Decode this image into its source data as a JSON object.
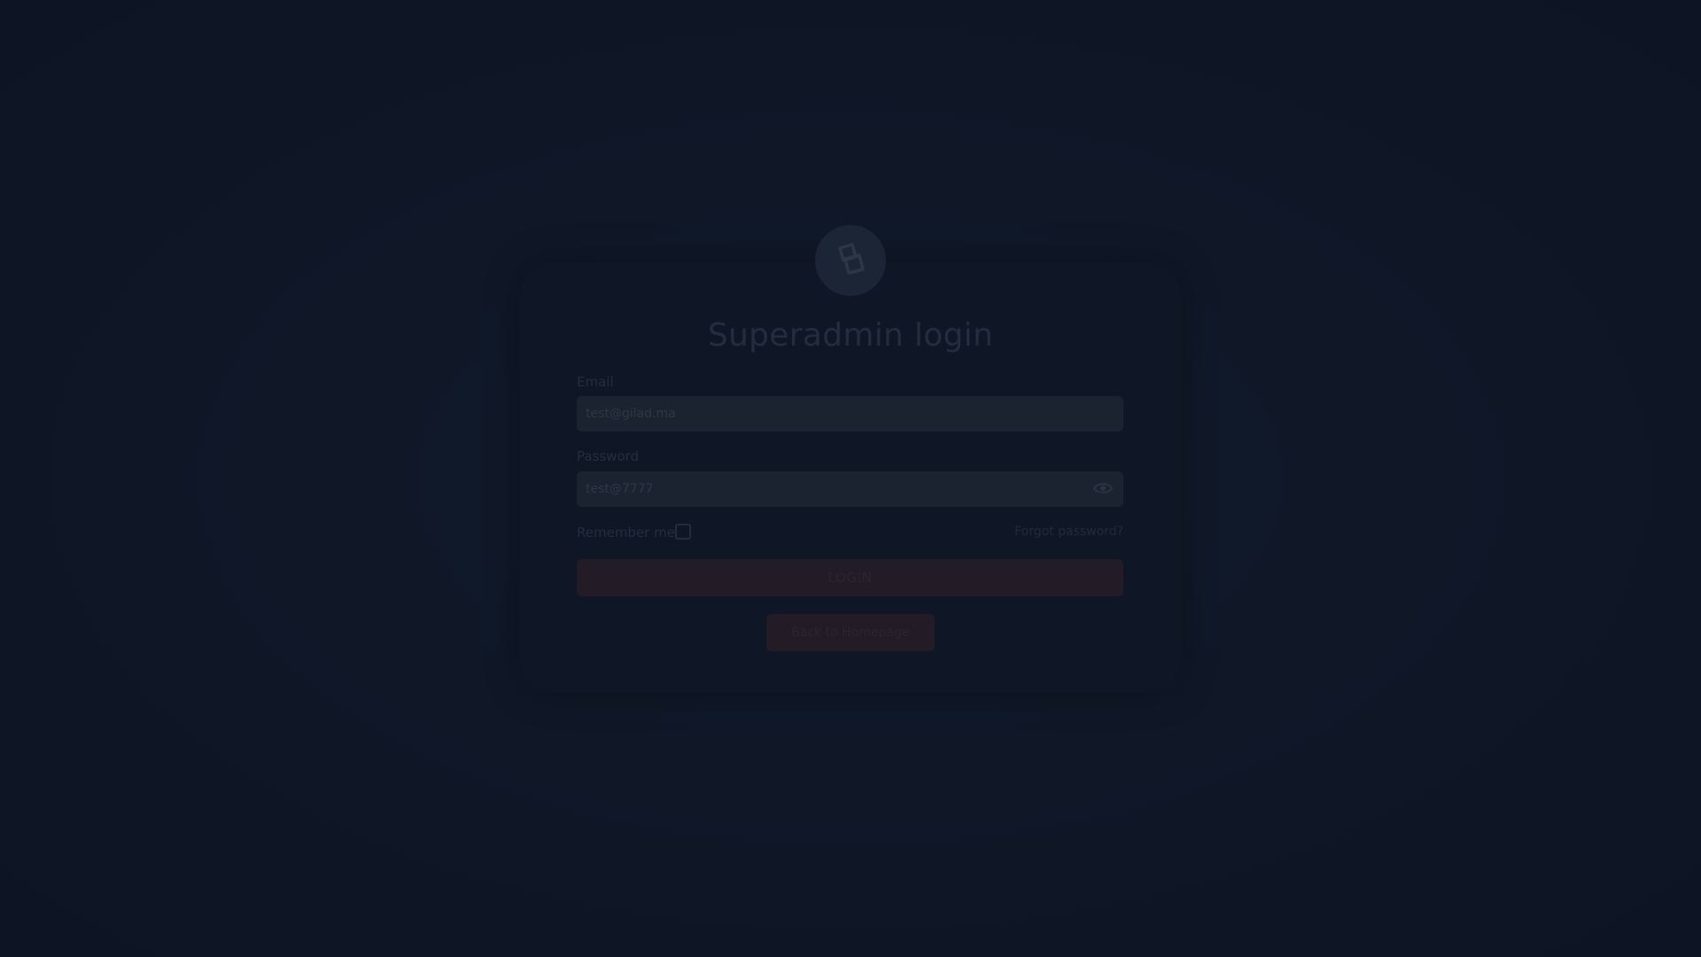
{
  "login": {
    "title": "Superadmin login",
    "email_label": "Email",
    "email_value": "test@gilad.ma",
    "password_label": "Password",
    "password_value": "test@7777",
    "remember_label": "Remember me",
    "remember_checked": false,
    "forgot_label": "Forgot password?",
    "login_label": "LOGIN",
    "back_label": "Back to Homepage",
    "logo_icon": "logo-icon",
    "eye_icon": "eye-icon"
  },
  "colors": {
    "background": "#101827",
    "card": "#0f1626",
    "accent": "#231b26"
  }
}
